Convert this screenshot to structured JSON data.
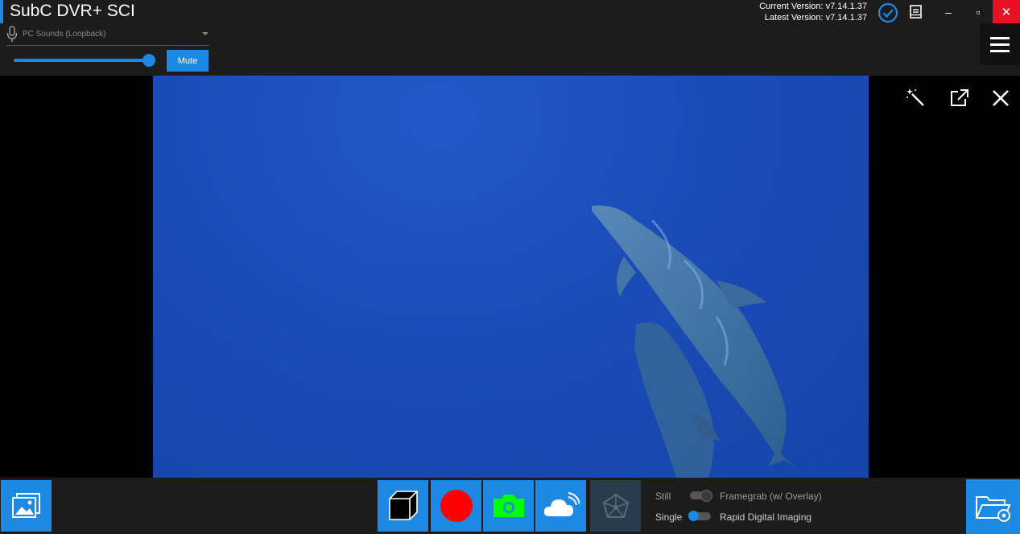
{
  "app": {
    "title": "SubC DVR+ SCI",
    "current_version": "Current Version: v7.14.1.37",
    "latest_version": "Latest Version: v7.14.1.37"
  },
  "window_controls": {
    "minimize": "–",
    "maximize": "▫",
    "close": "✕"
  },
  "audio": {
    "source": "PC Sounds (Loopback)",
    "volume": 1.0,
    "mute_label": "Mute"
  },
  "capture_modes": {
    "still_label": "Still",
    "still_option": "Framegrab (w/ Overlay)",
    "still_enabled": false,
    "single_label": "Single",
    "single_option": "Rapid Digital Imaging",
    "single_enabled": true
  },
  "colors": {
    "accent": "#1e88e5",
    "chrome": "#1c1c1c",
    "record": "#ff0000",
    "snapshot": "#00ff00",
    "close": "#e81123"
  },
  "icons": {
    "overlay": [
      "magic-wand-icon",
      "pop-out-icon",
      "close-icon"
    ],
    "bottom": [
      "gallery-icon",
      "cube-icon",
      "record-icon",
      "camera-icon",
      "cloud-stream-icon",
      "network-icon",
      "folder-settings-icon"
    ]
  }
}
